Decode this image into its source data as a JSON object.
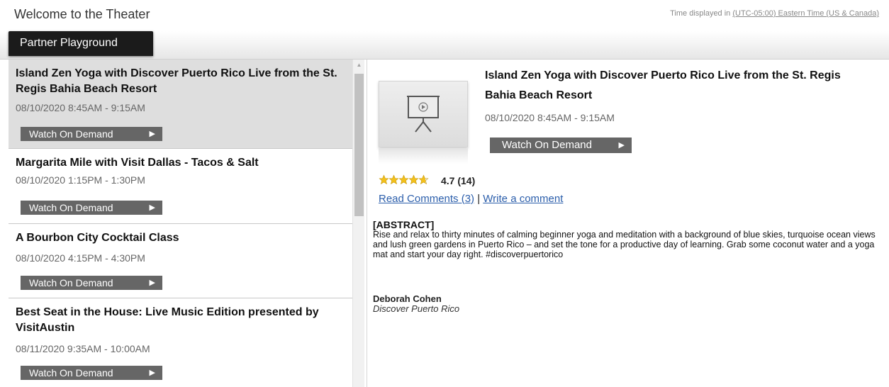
{
  "header": {
    "title": "Welcome to the Theater",
    "tz_prefix": "Time displayed in",
    "tz_link": "(UTC-05:00) Eastern Time (US & Canada)"
  },
  "tabs": [
    {
      "label": "Partner Playground",
      "active": true
    }
  ],
  "sessions": [
    {
      "title": "Island Zen Yoga with Discover Puerto Rico Live from the St. Regis Bahia Beach Resort",
      "time": "08/10/2020 8:45AM - 9:15AM",
      "button": "Watch On Demand",
      "selected": true
    },
    {
      "title": "Margarita Mile with Visit Dallas - Tacos & Salt",
      "time": "08/10/2020 1:15PM - 1:30PM",
      "button": "Watch On Demand",
      "selected": false
    },
    {
      "title": "A Bourbon City Cocktail Class",
      "time": "08/10/2020 4:15PM - 4:30PM",
      "button": "Watch On Demand",
      "selected": false
    },
    {
      "title": "Best Seat in the House: Live Music Edition presented by VisitAustin",
      "time": "08/11/2020 9:35AM - 10:00AM",
      "button": "Watch On Demand",
      "selected": false
    }
  ],
  "detail": {
    "title": "Island Zen Yoga with Discover Puerto Rico Live from the St. Regis Bahia Beach Resort",
    "time": "08/10/2020 8:45AM - 9:15AM",
    "button": "Watch On Demand",
    "rating": {
      "value": 4.7,
      "display": "4.7 (14)",
      "stars_total": 5
    },
    "read_comments": "Read Comments (3)",
    "separator": "|",
    "write_comment": "Write a comment",
    "abstract_label": "[ABSTRACT]",
    "abstract": "Rise and relax to thirty minutes of calming beginner yoga and meditation with a background of blue skies, turquoise ocean views and lush green gardens in Puerto Rico – and set the tone for a productive day of learning. Grab some coconut water and a yoga mat and start your day right. #discoverpuertorico",
    "speaker_name": "Deborah Cohen",
    "speaker_org": "Discover Puerto Rico"
  },
  "colors": {
    "star": "#f3c01b",
    "link": "#2b5eab",
    "button": "#666666",
    "selected_row": "#dedede",
    "tab": "#1b1b1b"
  },
  "icons": {
    "play": "play-triangle-icon",
    "thumbnail": "projector-screen-icon",
    "rating": "star-icon"
  }
}
